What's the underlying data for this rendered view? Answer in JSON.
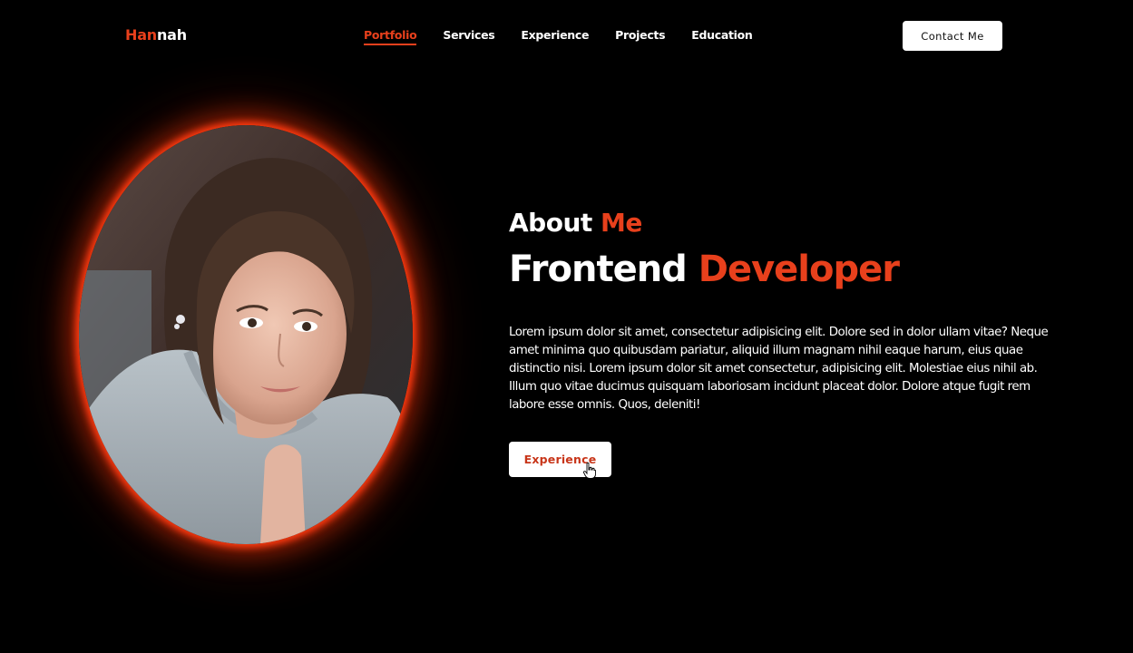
{
  "header": {
    "logo_part1": "Han",
    "logo_part2": "nah",
    "nav": [
      {
        "label": "Portfolio",
        "active": true
      },
      {
        "label": "Services",
        "active": false
      },
      {
        "label": "Experience",
        "active": false
      },
      {
        "label": "Projects",
        "active": false
      },
      {
        "label": "Education",
        "active": false
      }
    ],
    "contact_label": "Contact Me"
  },
  "hero": {
    "about_word1": "About",
    "about_word2": "Me",
    "role_word1": "Frontend",
    "role_word2": "Developer",
    "description": "Lorem ipsum dolor sit amet, consectetur adipisicing elit. Dolore sed in dolor ullam vitae? Neque amet minima quo quibusdam pariatur, aliquid illum magnam nihil eaque harum, eius quae distinctio nisi. Lorem ipsum dolor sit amet consectetur, adipisicing elit. Molestiae eius nihil ab. Illum quo vitae ducimus quisquam laboriosam incidunt placeat dolor. Dolore atque fugit rem labore esse omnis. Quos, deleniti!",
    "button_label": "Experience"
  },
  "colors": {
    "accent": "#e8401c",
    "background": "#000000",
    "text": "#ffffff"
  },
  "icons": {
    "cursor": "pointer-hand-cursor-icon"
  }
}
